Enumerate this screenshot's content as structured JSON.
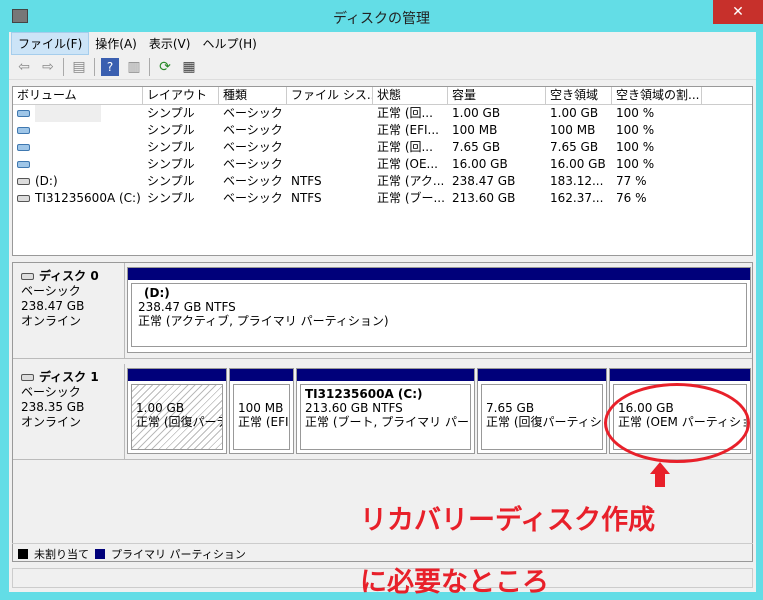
{
  "window": {
    "title": "ディスクの管理",
    "close": "✕"
  },
  "menu": [
    "ファイル(F)",
    "操作(A)",
    "表示(V)",
    "ヘルプ(H)"
  ],
  "columns": [
    "ボリューム",
    "レイアウト",
    "種類",
    "ファイル シス...",
    "状態",
    "容量",
    "空き領域",
    "空き領域の割..."
  ],
  "rows": [
    [
      "",
      "シンプル",
      "ベーシック",
      "",
      "正常 (回...",
      "1.00 GB",
      "1.00 GB",
      "100 %"
    ],
    [
      "",
      "シンプル",
      "ベーシック",
      "",
      "正常 (EFI...",
      "100 MB",
      "100 MB",
      "100 %"
    ],
    [
      "",
      "シンプル",
      "ベーシック",
      "",
      "正常 (回...",
      "7.65 GB",
      "7.65 GB",
      "100 %"
    ],
    [
      "",
      "シンプル",
      "ベーシック",
      "",
      "正常 (OE...",
      "16.00 GB",
      "16.00 GB",
      "100 %"
    ],
    [
      "(D:)",
      "シンプル",
      "ベーシック",
      "NTFS",
      "正常 (アク...",
      "238.47 GB",
      "183.12...",
      "77 %"
    ],
    [
      "TI31235600A (C:)",
      "シンプル",
      "ベーシック",
      "NTFS",
      "正常 (ブー...",
      "213.60 GB",
      "162.37...",
      "76 %"
    ]
  ],
  "disk0": {
    "name": "ディスク 0",
    "type": "ベーシック",
    "size": "238.47 GB",
    "state": "オンライン",
    "part": {
      "name": "(D:)",
      "size": "238.47 GB NTFS",
      "status": "正常 (アクティブ, プライマリ パーティション)"
    }
  },
  "disk1": {
    "name": "ディスク 1",
    "type": "ベーシック",
    "size": "238.35 GB",
    "state": "オンライン",
    "parts": [
      {
        "size": "1.00 GB",
        "status": "正常 (回復パーティション)"
      },
      {
        "size": "100 MB",
        "status": "正常 (EFI システム パーティション)"
      },
      {
        "name": "TI31235600A  (C:)",
        "size": "213.60 GB NTFS",
        "status": "正常 (ブート, プライマリ パーティション)"
      },
      {
        "size": "7.65 GB",
        "status": "正常 (回復パーティション)"
      },
      {
        "size": "16.00 GB",
        "status": "正常 (OEM パーティション)"
      }
    ]
  },
  "legend": {
    "unallocated": "未割り当て",
    "primary": "プライマリ パーティション"
  },
  "annotation": {
    "line1": "リカバリーディスク作成",
    "line2": "に必要なところ"
  },
  "colors": {
    "primary": "#00007a",
    "annotation": "#e8202a"
  }
}
